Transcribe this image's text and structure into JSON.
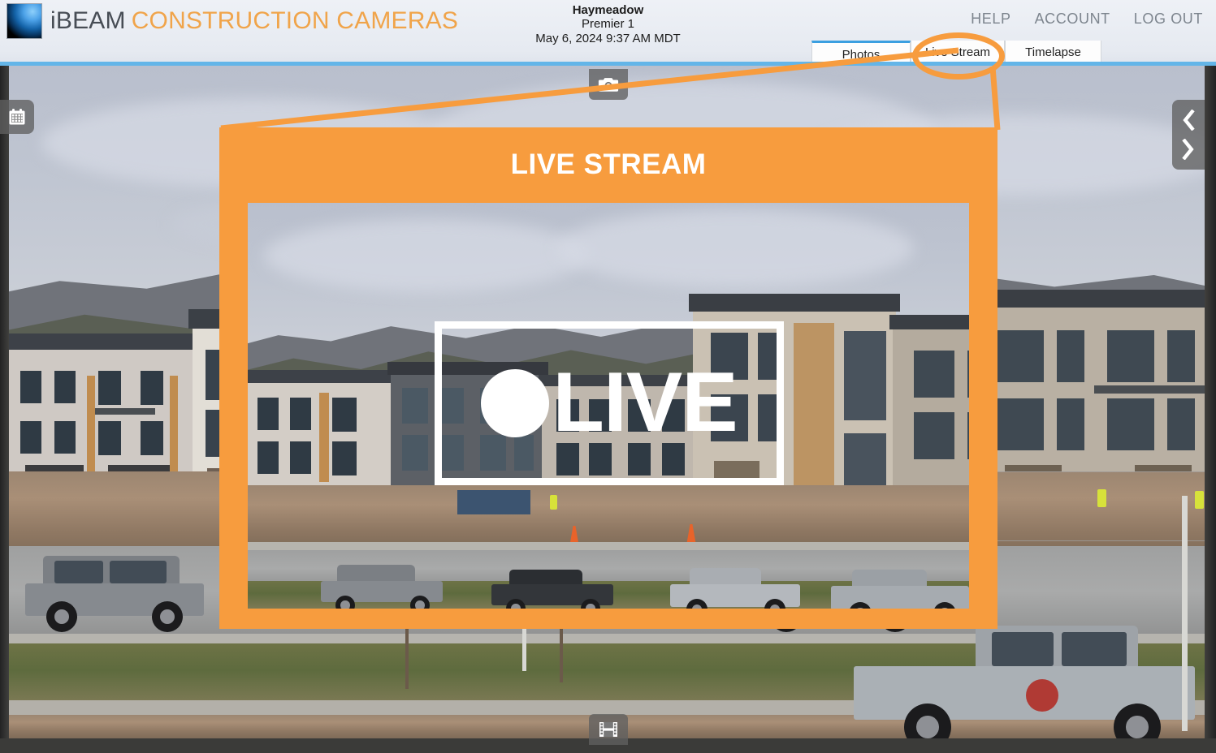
{
  "header": {
    "brand_primary": "iBEAM",
    "brand_secondary": "CONSTRUCTION CAMERAS",
    "logo_icon": "ibeam-sphere-logo",
    "site_name": "Haymeadow",
    "camera_name": "Premier 1",
    "timestamp": "May 6, 2024 9:37 AM MDT",
    "nav": [
      {
        "label": "HELP",
        "name": "help"
      },
      {
        "label": "ACCOUNT",
        "name": "account"
      },
      {
        "label": "LOG OUT",
        "name": "log-out"
      }
    ],
    "tabs": [
      {
        "label": "Photos",
        "name": "photos",
        "active": true
      },
      {
        "label": "Live Stream",
        "name": "live-stream",
        "active": false
      },
      {
        "label": "Timelapse",
        "name": "timelapse",
        "active": false
      }
    ]
  },
  "viewer": {
    "calendar_icon": "calendar-icon",
    "camera_icon": "camera-icon",
    "film_icon": "film-strip-icon",
    "prev_icon": "chevron-left-icon",
    "next_icon": "chevron-right-icon"
  },
  "callout": {
    "title": "LIVE STREAM",
    "live_badge_text": "LIVE",
    "live_badge_dot": "live-record-dot",
    "accent_color": "#f79c3e",
    "highlight_target": "Live Stream"
  },
  "colors": {
    "accent_orange": "#f79c3e",
    "brand_orange": "#f0a44a",
    "tab_active_blue": "#3b9fe0",
    "header_rule_blue": "#63b5e8",
    "nav_grey": "#7d858e"
  }
}
